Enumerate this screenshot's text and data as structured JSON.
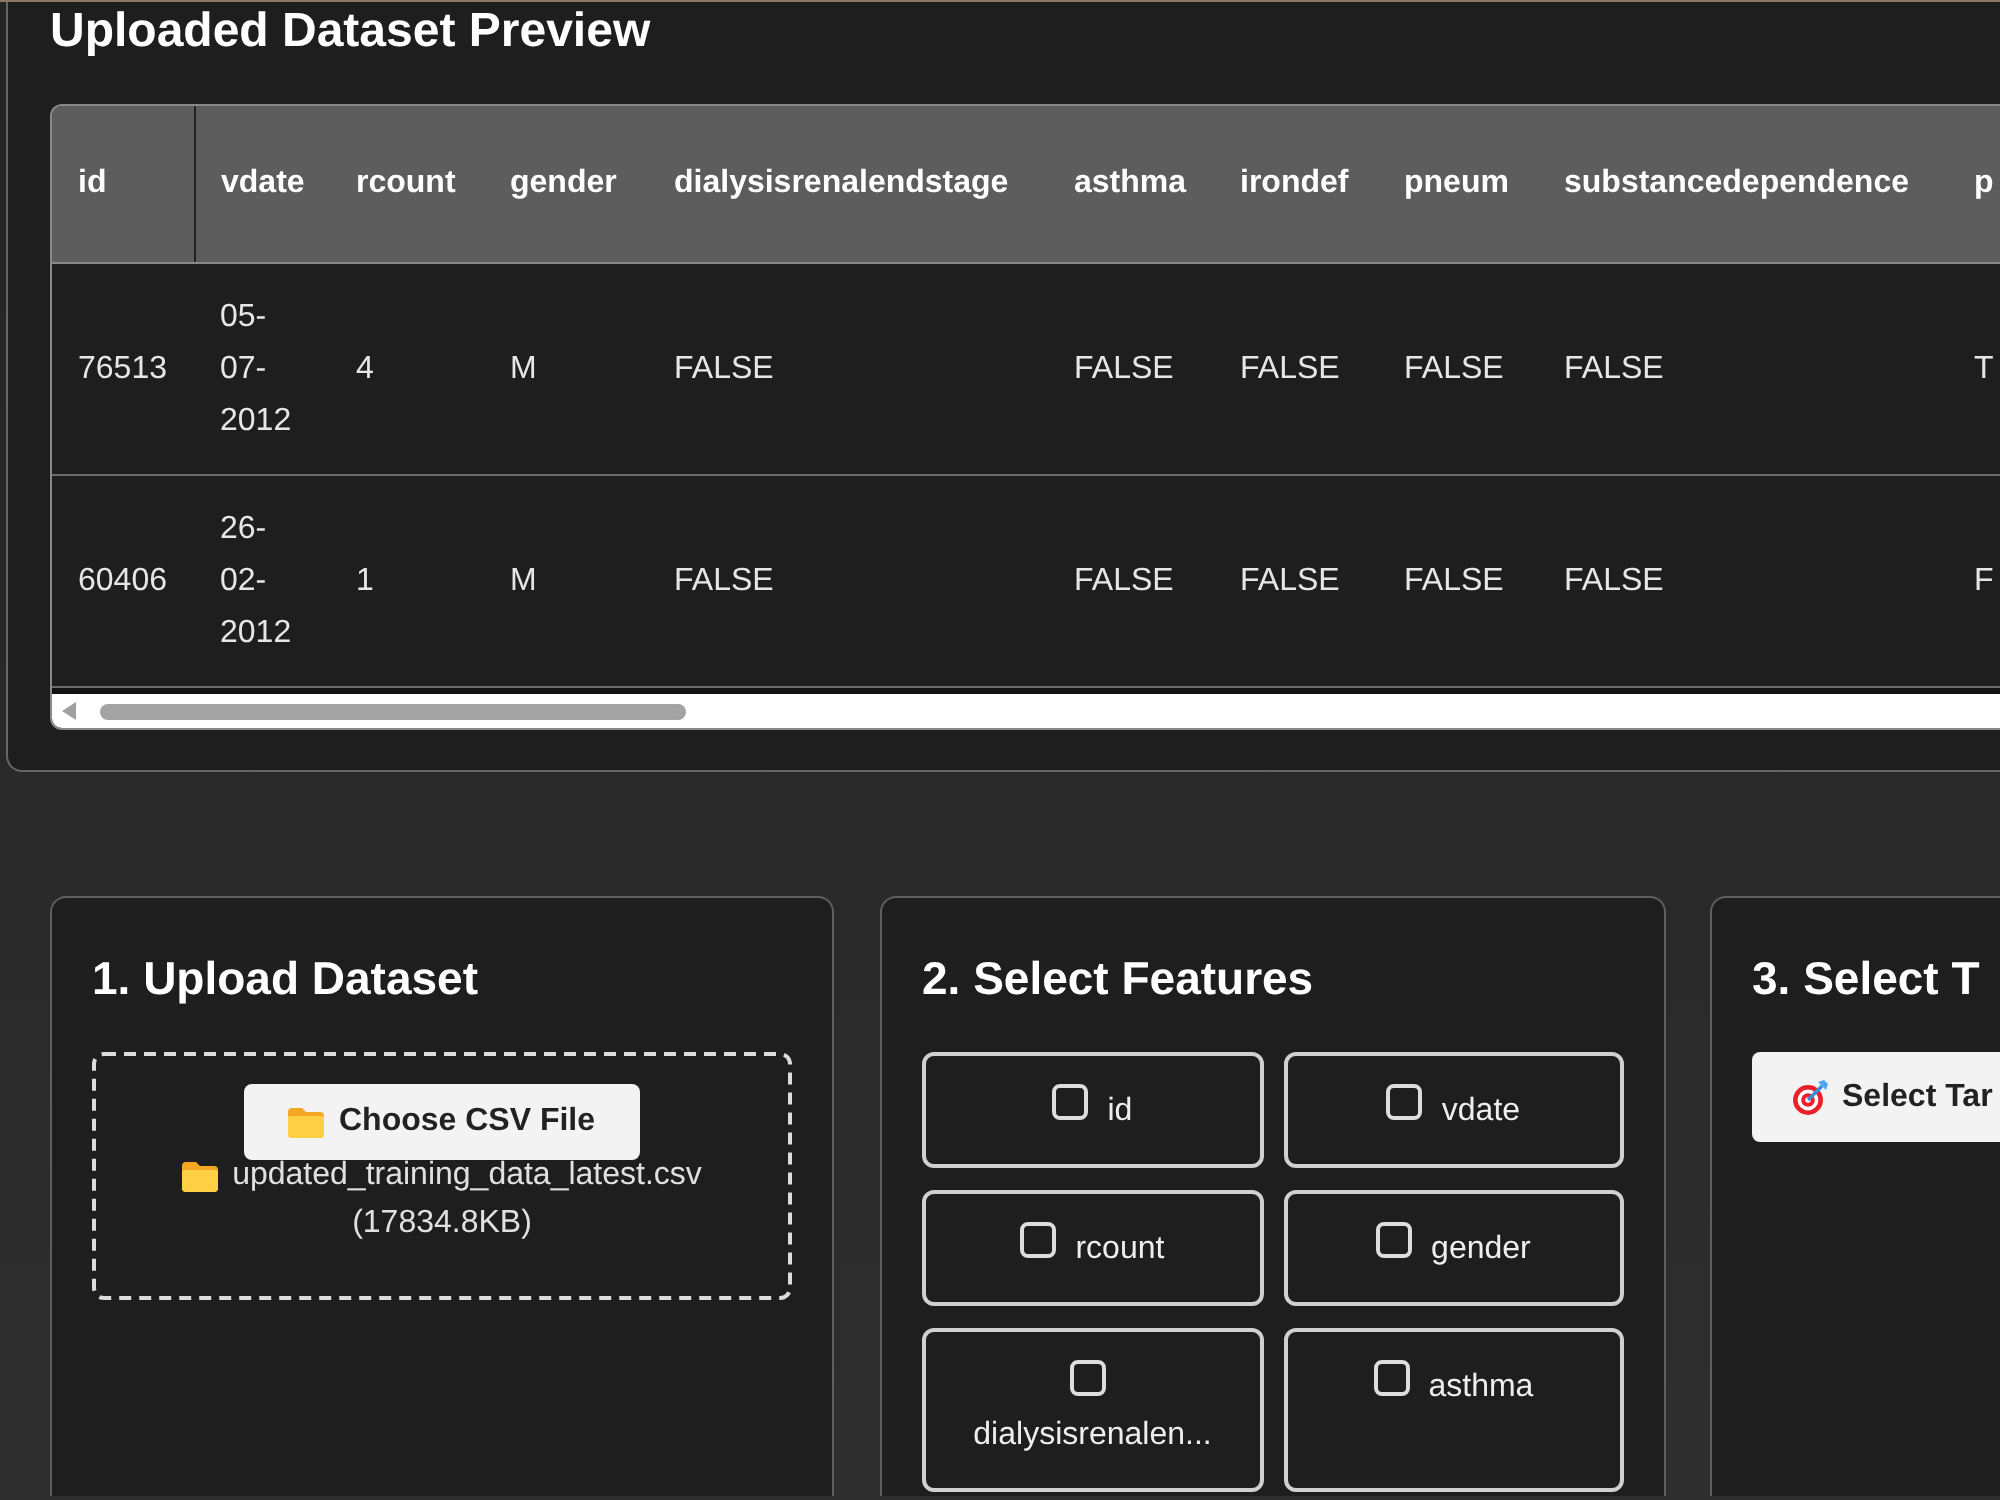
{
  "preview": {
    "title": "Uploaded Dataset Preview",
    "table": {
      "columns": [
        "id",
        "vdate",
        "rcount",
        "gender",
        "dialysisrenalendstage",
        "asthma",
        "irondef",
        "pneum",
        "substancedependence",
        "p"
      ],
      "rows": [
        [
          "76513",
          "05-07-2012",
          "4",
          "M",
          "FALSE",
          "FALSE",
          "FALSE",
          "FALSE",
          "FALSE",
          "T"
        ],
        [
          "60406",
          "26-02-2012",
          "1",
          "M",
          "FALSE",
          "FALSE",
          "FALSE",
          "FALSE",
          "FALSE",
          "F"
        ]
      ]
    }
  },
  "upload": {
    "title": "1. Upload Dataset",
    "button": "Choose CSV File",
    "file_name": "updated_training_data_latest.csv",
    "file_size": "(17834.8KB)"
  },
  "features": {
    "title": "2. Select Features",
    "items": [
      {
        "label": "id",
        "checked": false
      },
      {
        "label": "vdate",
        "checked": false
      },
      {
        "label": "rcount",
        "checked": false
      },
      {
        "label": "gender",
        "checked": false
      },
      {
        "label": "dialysisrenalen...",
        "checked": false
      },
      {
        "label": "asthma",
        "checked": false
      }
    ]
  },
  "target": {
    "title": "3. Select T",
    "button": "Select Tar"
  }
}
